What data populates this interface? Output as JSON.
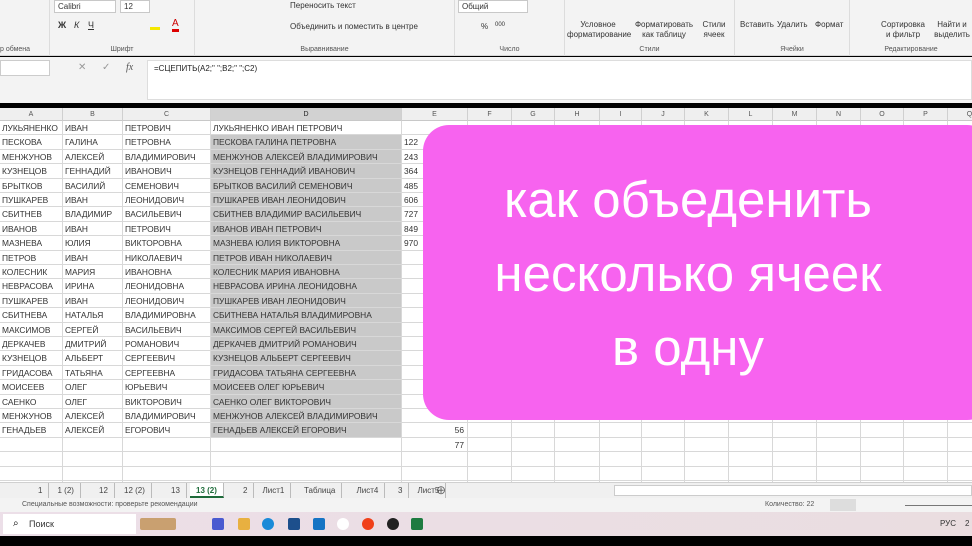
{
  "ribbon": {
    "clipboard_label": "р обмена",
    "font_name": "Calibri",
    "font_size": "12",
    "bold": "Ж",
    "italic": "К",
    "underline": "Ч",
    "font_label": "Шрифт",
    "wrap_text": "Переносить текст",
    "merge_center": "Объединить и поместить в центре",
    "alignment_label": "Выравнивание",
    "number_format": "Общий",
    "percent": "%",
    "thousands": "000",
    "number_label": "Число",
    "conditional_formatting": "Условное форматирование",
    "format_as_table": "Форматировать как таблицу",
    "cell_styles": "Стили ячеек",
    "styles_label": "Стили",
    "insert": "Вставить",
    "delete": "Удалить",
    "format": "Формат",
    "cells_label": "Ячейки",
    "sort_filter": "Сортировка и фильтр",
    "find_select": "Найти и выделить",
    "editing_label": "Редактирование"
  },
  "formula_bar": {
    "fx": "fx",
    "cancel": "✕",
    "enter": "✓",
    "formula": "=СЦЕПИТЬ(A2;\" \";B2;\" \";C2)"
  },
  "columns": [
    "A",
    "B",
    "C",
    "D",
    "E",
    "F",
    "G",
    "H",
    "I",
    "J",
    "K",
    "L",
    "M",
    "N",
    "O",
    "P",
    "Q"
  ],
  "rows": [
    [
      "ЛУКЬЯНЕНКО",
      "ИВАН",
      "ПЕТРОВИЧ",
      "ЛУКЬЯНЕНКО ИВАН ПЕТРОВИЧ",
      ""
    ],
    [
      "ПЕСКОВА",
      "ГАЛИНА",
      "ПЕТРОВНА",
      "ПЕСКОВА ГАЛИНА ПЕТРОВНА",
      "122"
    ],
    [
      "МЕНЖУНОВ",
      "АЛЕКСЕЙ",
      "ВЛАДИМИРОВИЧ",
      "МЕНЖУНОВ АЛЕКСЕЙ ВЛАДИМИРОВИЧ",
      "243"
    ],
    [
      "КУЗНЕЦОВ",
      "ГЕННАДИЙ",
      "ИВАНОВИЧ",
      "КУЗНЕЦОВ ГЕННАДИЙ ИВАНОВИЧ",
      "364"
    ],
    [
      "БРЫТКОВ",
      "ВАСИЛИЙ",
      "СЕМЕНОВИЧ",
      "БРЫТКОВ ВАСИЛИЙ СЕМЕНОВИЧ",
      "485"
    ],
    [
      "ПУШКАРЕВ",
      "ИВАН",
      "ЛЕОНИДОВИЧ",
      "ПУШКАРЕВ ИВАН ЛЕОНИДОВИЧ",
      "606"
    ],
    [
      "СБИТНЕВ",
      "ВЛАДИМИР",
      "ВАСИЛЬЕВИЧ",
      "СБИТНЕВ ВЛАДИМИР ВАСИЛЬЕВИЧ",
      "727"
    ],
    [
      "ИВАНОВ",
      "ИВАН",
      "ПЕТРОВИЧ",
      "ИВАНОВ ИВАН ПЕТРОВИЧ",
      "849"
    ],
    [
      "МАЗНЕВА",
      "ЮЛИЯ",
      "ВИКТОРОВНА",
      "МАЗНЕВА ЮЛИЯ ВИКТОРОВНА",
      "970"
    ],
    [
      "ПЕТРОВ",
      "ИВАН",
      "НИКОЛАЕВИЧ",
      "ПЕТРОВ ИВАН НИКОЛАЕВИЧ",
      ""
    ],
    [
      "КОЛЕСНИК",
      "МАРИЯ",
      "ИВАНОВНА",
      "КОЛЕСНИК МАРИЯ ИВАНОВНА",
      ""
    ],
    [
      "НЕВРАСОВА",
      "ИРИНА",
      "ЛЕОНИДОВНА",
      "НЕВРАСОВА ИРИНА ЛЕОНИДОВНА",
      ""
    ],
    [
      "ПУШКАРЕВ",
      "ИВАН",
      "ЛЕОНИДОВИЧ",
      "ПУШКАРЕВ ИВАН ЛЕОНИДОВИЧ",
      ""
    ],
    [
      "СБИТНЕВА",
      "НАТАЛЬЯ",
      "ВЛАДИМИРОВНА",
      "СБИТНЕВА НАТАЛЬЯ ВЛАДИМИРОВНА",
      ""
    ],
    [
      "МАКСИМОВ",
      "СЕРГЕЙ",
      "ВАСИЛЬЕВИЧ",
      "МАКСИМОВ СЕРГЕЙ ВАСИЛЬЕВИЧ",
      ""
    ],
    [
      "ДЕРКАЧЕВ",
      "ДМИТРИЙ",
      "РОМАНОВИЧ",
      "ДЕРКАЧЕВ ДМИТРИЙ РОМАНОВИЧ",
      ""
    ],
    [
      "КУЗНЕЦОВ",
      "АЛЬБЕРТ",
      "СЕРГЕЕВИЧ",
      "КУЗНЕЦОВ АЛЬБЕРТ СЕРГЕЕВИЧ",
      ""
    ],
    [
      "ГРИДАСОВА",
      "ТАТЬЯНА",
      "СЕРГЕЕВНА",
      "ГРИДАСОВА ТАТЬЯНА СЕРГЕЕВНА",
      ""
    ],
    [
      "МОИСЕЕВ",
      "ОЛЕГ",
      "ЮРЬЕВИЧ",
      "МОИСЕЕВ ОЛЕГ ЮРЬЕВИЧ",
      ""
    ],
    [
      "САЕНКО",
      "ОЛЕГ",
      "ВИКТОРОВИЧ",
      "САЕНКО ОЛЕГ ВИКТОРОВИЧ",
      ""
    ],
    [
      "МЕНЖУНОВ",
      "АЛЕКСЕЙ",
      "ВЛАДИМИРОВИЧ",
      "МЕНЖУНОВ АЛЕКСЕЙ ВЛАДИМИРОВИЧ",
      ""
    ],
    [
      "ГЕНАДЬЕВ",
      "АЛЕКСЕЙ",
      "ЕГОРОВИЧ",
      "ГЕНАДЬЕВ АЛЕКСЕЙ ЕГОРОВИЧ",
      "56"
    ],
    [
      "",
      "",
      "",
      "",
      "77"
    ]
  ],
  "overlay": {
    "line1": "как объеденить",
    "line2": "несколько ячеек",
    "line3": "в одну",
    "color": "#f763ef"
  },
  "sheet_tabs": [
    "1",
    "1 (2)",
    "12",
    "12 (2)",
    "13",
    "13 (2)",
    "2",
    "Лист1",
    "Таблица",
    "Лист4",
    "3",
    "Лист5"
  ],
  "active_tab": "13 (2)",
  "status": {
    "accessibility": "Специальные возможности: проверьте рекомендации",
    "count": "Количество: 22"
  },
  "taskbar": {
    "search": "Поиск",
    "lang": "РУС",
    "time": "2"
  }
}
